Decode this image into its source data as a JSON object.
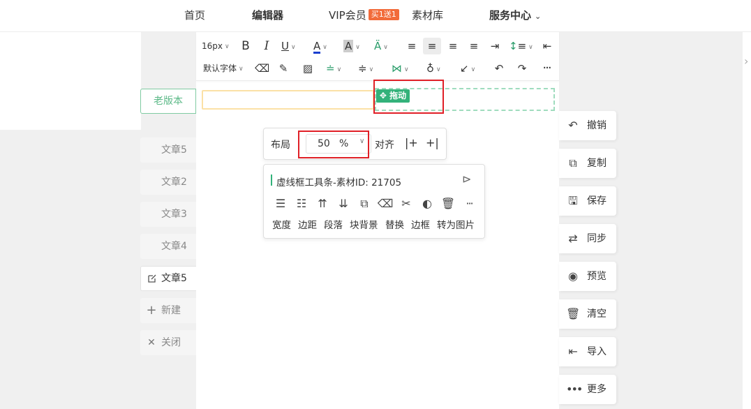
{
  "nav": {
    "home": "首页",
    "editor": "编辑器",
    "vip": "VIP会员",
    "vip_badge": "买1送1",
    "materials": "素材库",
    "service": "服务中心"
  },
  "left": {
    "old_version": "老版本",
    "tabs": [
      {
        "label": "文章5",
        "active": false,
        "icon": ""
      },
      {
        "label": "文章2",
        "active": false,
        "icon": ""
      },
      {
        "label": "文章3",
        "active": false,
        "icon": ""
      },
      {
        "label": "文章4",
        "active": false,
        "icon": ""
      },
      {
        "label": "文章5",
        "active": true,
        "icon": "edit-icon"
      },
      {
        "label": "新建",
        "active": false,
        "icon": "plus-icon"
      },
      {
        "label": "关闭",
        "active": false,
        "icon": "close-icon"
      }
    ]
  },
  "toolbar": {
    "font_size": "16px",
    "font_family": "默认字体"
  },
  "canvas": {
    "drag_label": "拖动"
  },
  "layout_panel": {
    "layout_label": "布局",
    "percent_value": "50",
    "percent_unit": "%",
    "align_label": "对齐"
  },
  "tools_panel": {
    "title": "虚线框工具条-素材ID: 21705",
    "labels": [
      "宽度",
      "边距",
      "段落",
      "块背景",
      "替换",
      "边框",
      "转为图片"
    ]
  },
  "right_actions": [
    {
      "label": "撤销",
      "icon": "undo-icon"
    },
    {
      "label": "复制",
      "icon": "copy-icon"
    },
    {
      "label": "保存",
      "icon": "save-icon"
    },
    {
      "label": "同步",
      "icon": "sync-icon"
    },
    {
      "label": "预览",
      "icon": "eye-icon"
    },
    {
      "label": "清空",
      "icon": "trash-icon"
    },
    {
      "label": "导入",
      "icon": "import-icon"
    },
    {
      "label": "更多",
      "icon": "more-icon"
    }
  ],
  "colors": {
    "accent_green": "#33b27a",
    "highlight_red": "#e01f26",
    "vip_orange": "#f26b3a"
  }
}
